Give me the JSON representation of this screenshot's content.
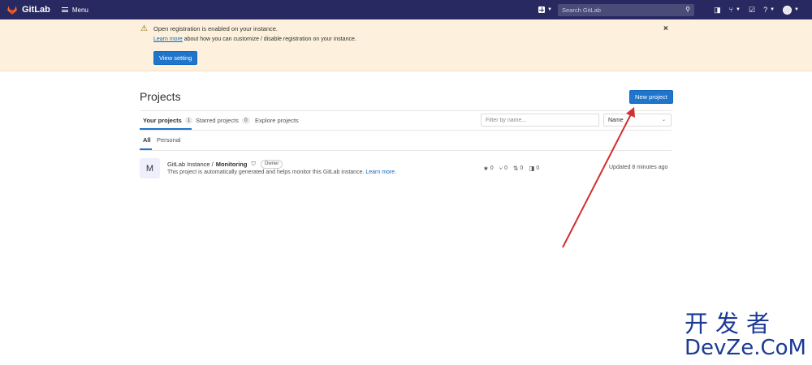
{
  "topbar": {
    "brand": "GitLab",
    "menu_label": "Menu",
    "search_placeholder": "Search GitLab",
    "icons": [
      "plus-icon",
      "search-icon",
      "issues-icon",
      "merge-request-icon",
      "todo-icon",
      "help-icon",
      "avatar"
    ]
  },
  "alert": {
    "title": "Open registration is enabled on your instance.",
    "link_text": "Learn more",
    "text_rest": " about how you can customize / disable registration on your instance.",
    "button_label": "View setting",
    "close_glyph": "×"
  },
  "page": {
    "title": "Projects",
    "new_project_label": "New project"
  },
  "tabs": [
    {
      "label": "Your projects",
      "count": "1"
    },
    {
      "label": "Starred projects",
      "count": "0"
    },
    {
      "label": "Explore projects",
      "count": ""
    }
  ],
  "filter": {
    "placeholder": "Filter by name...",
    "sort_label": "Name"
  },
  "subtabs": [
    {
      "label": "All"
    },
    {
      "label": "Personal"
    }
  ],
  "project": {
    "avatar_letter": "M",
    "namespace": "GitLab Instance /",
    "name": "Monitoring",
    "role": "Owner",
    "description": "This project is automatically generated and helps monitor this GitLab instance.",
    "description_link": "Learn more.",
    "stars": "0",
    "forks": "0",
    "merge_requests": "0",
    "issues": "0",
    "updated": "Updated 8 minutes ago"
  },
  "watermark": {
    "chinese": "开发者",
    "latin": "DevZe.CoM"
  },
  "colors": {
    "topbar": "#292961",
    "primary": "#1f75cb",
    "alert_bg": "#fdf1dd",
    "annotation_arrow": "#d32f2f"
  }
}
